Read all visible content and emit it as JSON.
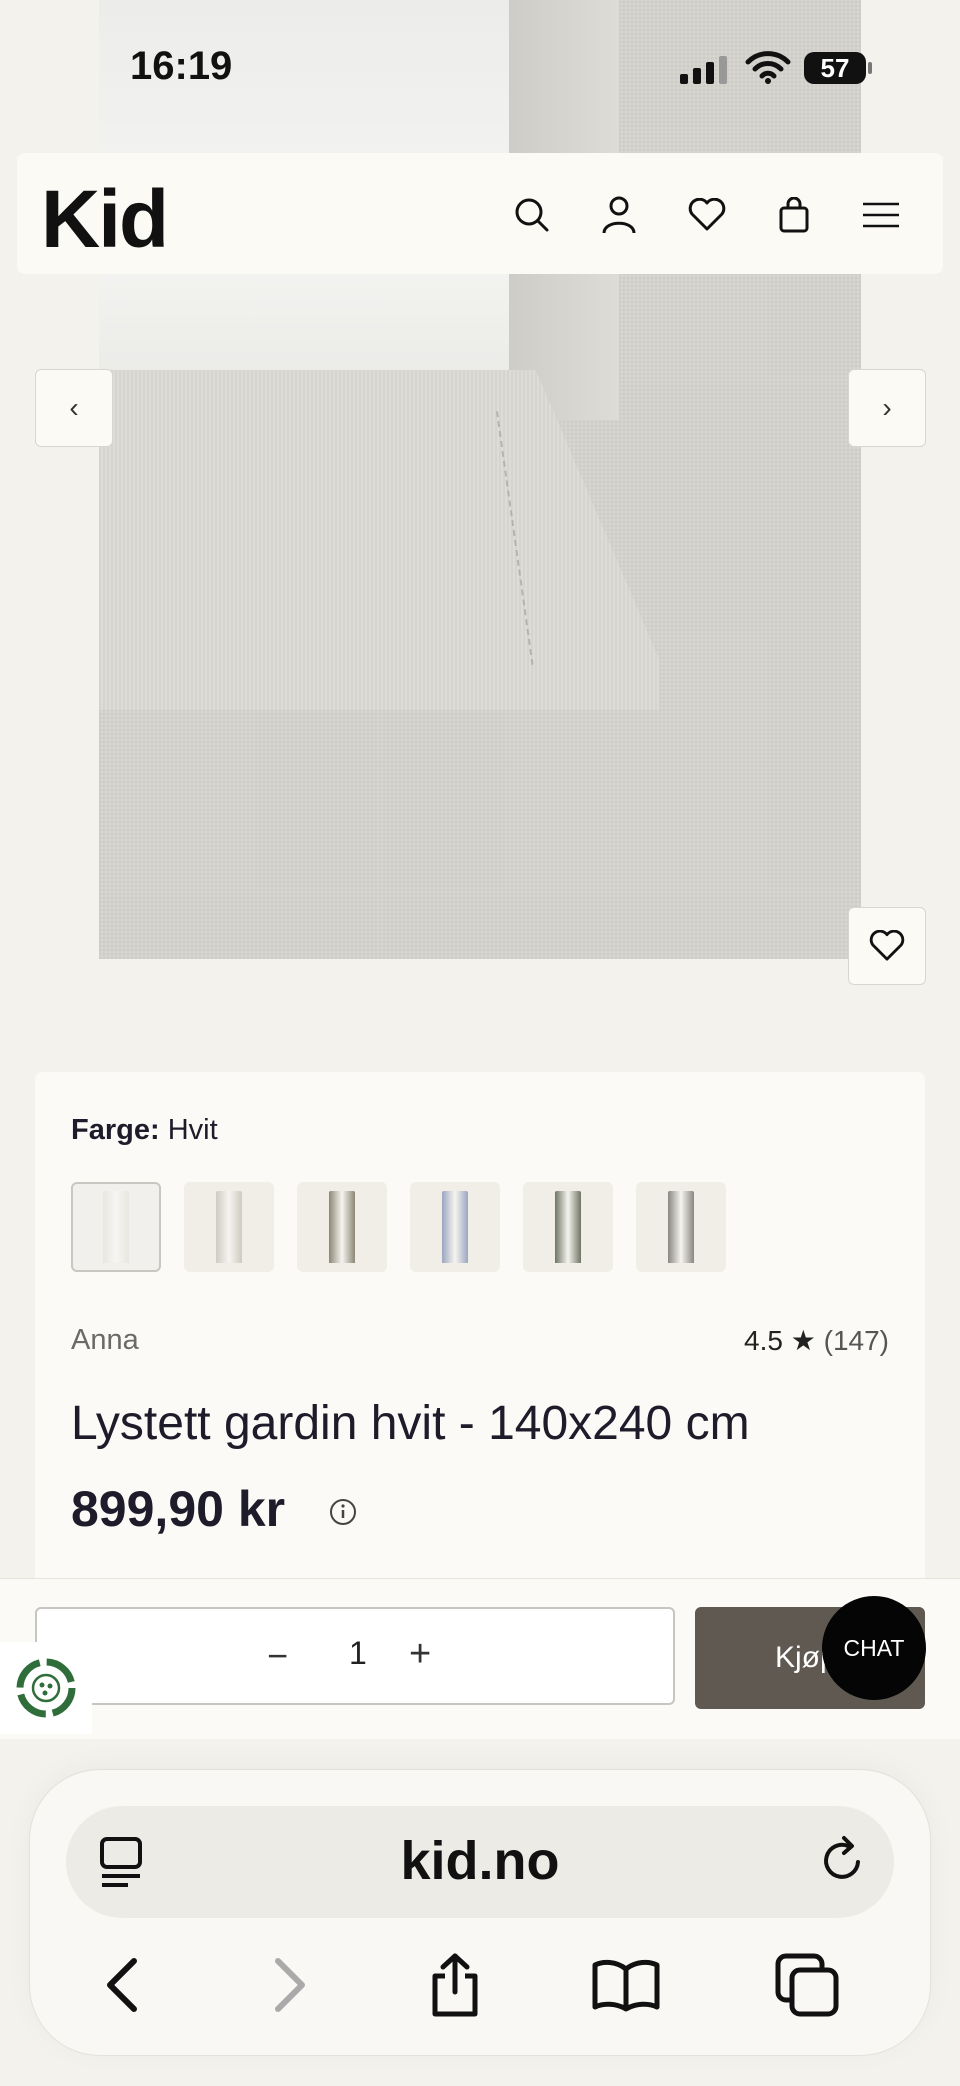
{
  "status_bar": {
    "time": "16:19",
    "battery": "57"
  },
  "header": {
    "logo": "Kid"
  },
  "carousel": {
    "prev_label": "‹",
    "next_label": "›"
  },
  "product": {
    "color_label": "Farge:",
    "color_value": "Hvit",
    "swatches": [
      {
        "name": "Hvit",
        "color": "#e8e6e0"
      },
      {
        "name": "Beige",
        "color": "#cfcbc0"
      },
      {
        "name": "Oliven",
        "color": "#8c8776"
      },
      {
        "name": "Lyseblå",
        "color": "#9aa6c0"
      },
      {
        "name": "Grønn",
        "color": "#6f7564"
      },
      {
        "name": "Grå",
        "color": "#8a8682"
      }
    ],
    "brand": "Anna",
    "rating": "4.5",
    "rating_star": "★",
    "review_count": "(147)",
    "title": "Lystett gardin hvit - 140x240 cm",
    "price": "899,90 kr"
  },
  "purchase": {
    "minus": "−",
    "quantity": "1",
    "plus": "+",
    "buy_label": "Kjøp",
    "chat_label": "CHAT"
  },
  "browser": {
    "url": "kid.no"
  },
  "colors": {
    "buy_button": "#5f5951",
    "background": "#f4f2ec"
  }
}
